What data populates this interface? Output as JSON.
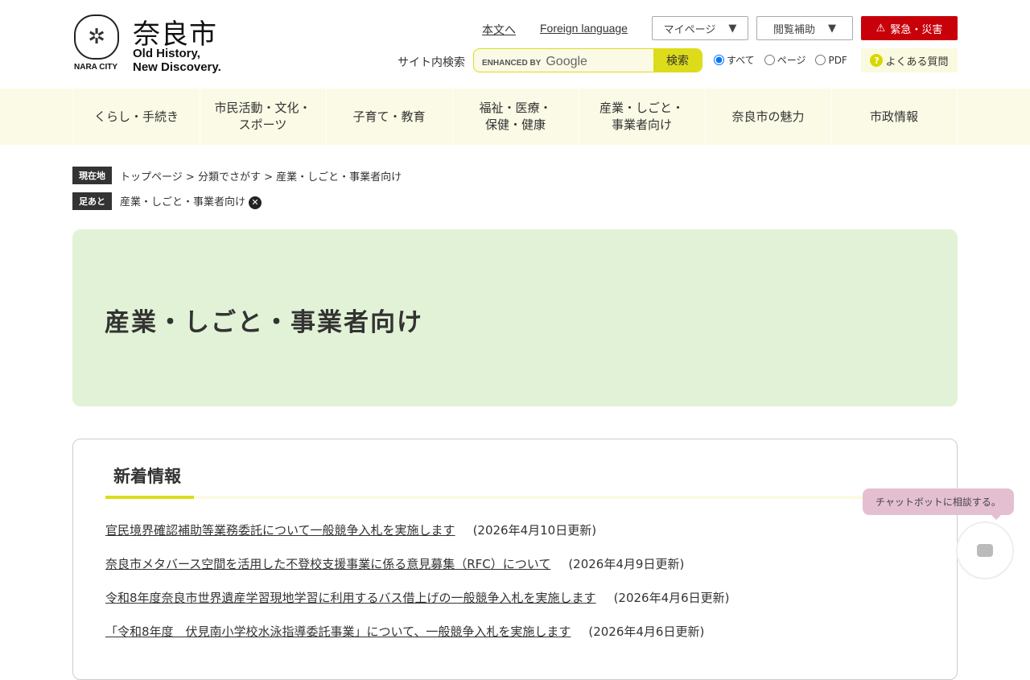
{
  "logo": {
    "kanji": "奈良市",
    "slogan_line1": "Old History,",
    "slogan_line2": "New Discovery.",
    "city": "NARA CITY"
  },
  "header": {
    "skip_link": "本文へ",
    "foreign": "Foreign language",
    "mypage": "マイページ",
    "accessibility": "閲覧補助",
    "emergency": "緊急・災害",
    "search_label": "サイト内検索",
    "search_placeholder": "ENHANCED BY",
    "search_brand": "Google",
    "search_button": "検索",
    "scope": [
      "すべて",
      "ページ",
      "PDF"
    ],
    "faq": "よくある質問"
  },
  "nav": [
    "くらし・手続き",
    "市民活動・文化・\nスポーツ",
    "子育て・教育",
    "福祉・医療・\n保健・健康",
    "産業・しごと・\n事業者向け",
    "奈良市の魅力",
    "市政情報"
  ],
  "breadcrumb": {
    "tag": "現在地",
    "items": [
      "トップページ",
      "分類でさがす"
    ],
    "sep": ">",
    "current": "産業・しごと・事業者向け"
  },
  "footprint": {
    "tag": "足あと",
    "item": "産業・しごと・事業者向け"
  },
  "page_title": "産業・しごと・事業者向け",
  "news": {
    "title": "新着情報",
    "items": [
      {
        "title": "官民境界確認補助等業務委託について一般競争入札を実施します",
        "date": "(2026年4月10日更新)"
      },
      {
        "title": "奈良市メタバース空間を活用した不登校支援事業に係る意見募集（RFC）について",
        "date": "(2026年4月9日更新)"
      },
      {
        "title": "令和8年度奈良市世界遺産学習現地学習に利用するバス借上げの一般競争入札を実施します",
        "date": "(2026年4月6日更新)"
      },
      {
        "title": "「令和8年度　伏見南小学校水泳指導委託事業」について、一般競争入札を実施します",
        "date": "(2026年4月6日更新)"
      }
    ]
  },
  "chatbot": "チャットボットに相談する。"
}
